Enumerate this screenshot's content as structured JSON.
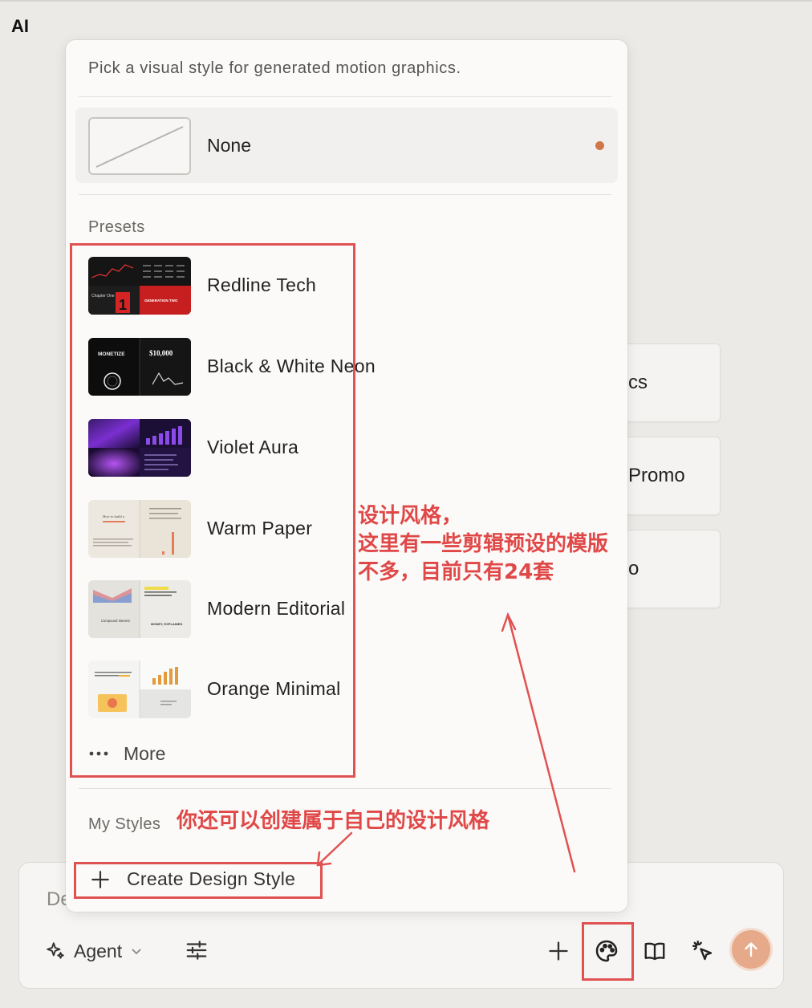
{
  "app": {
    "title": "AI"
  },
  "background_cards": [
    {
      "label": "cs"
    },
    {
      "label": "Promo"
    },
    {
      "label": "o"
    }
  ],
  "composer": {
    "placeholder": "De",
    "agent_label": "Agent",
    "icons": [
      "sparkles-icon",
      "chevron-down-icon",
      "sliders-icon",
      "plus-icon",
      "palette-icon",
      "book-icon",
      "cursor-click-icon",
      "arrow-up-icon"
    ],
    "send_color": "#e6a98a"
  },
  "style_picker": {
    "description": "Pick a visual style for generated motion graphics.",
    "none_option": {
      "label": "None",
      "selected": true,
      "indicator_color": "#cf7748"
    },
    "presets_title": "Presets",
    "presets": [
      {
        "label": "Redline Tech",
        "thumb_text": [
          "Chapter One",
          "1",
          "GENERATION TWO"
        ]
      },
      {
        "label": "Black & White Neon",
        "thumb_text": [
          "MONETIZE",
          "$10,000"
        ]
      },
      {
        "label": "Violet Aura"
      },
      {
        "label": "Warm Paper",
        "thumb_text": [
          "How to build a"
        ]
      },
      {
        "label": "Modern Editorial",
        "thumb_text": [
          "Compound Interest",
          "MONEY, EXPLAINED"
        ]
      },
      {
        "label": "Orange Minimal"
      }
    ],
    "more_label": "More",
    "my_styles_title": "My Styles",
    "create_label": "Create Design Style"
  },
  "annotations": {
    "presets_note": [
      "设计风格，",
      "这里有一些剪辑预设的模版",
      "不多，目前只有24套"
    ],
    "my_styles_note": "你还可以创建属于自己的设计风格",
    "color": "#e05252"
  }
}
